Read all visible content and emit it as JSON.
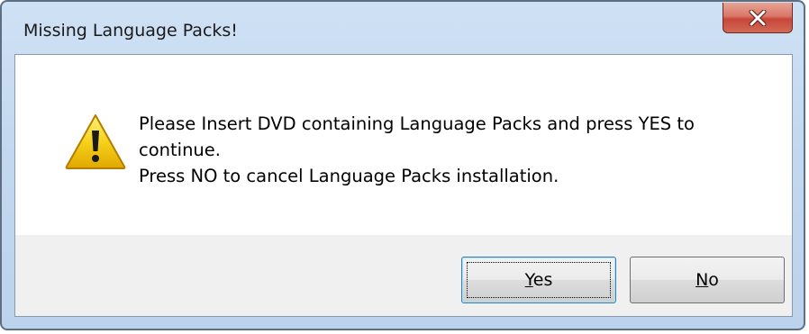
{
  "window": {
    "title": "Missing Language Packs!",
    "close_icon": "close-icon"
  },
  "dialog": {
    "icon": "warning-icon",
    "message_lines": [
      "Please Insert DVD containing Language Packs and press YES to",
      "continue.",
      "Press NO to cancel Language Packs installation."
    ]
  },
  "buttons": {
    "yes": {
      "mnemonic": "Y",
      "rest": "es",
      "default": true
    },
    "no": {
      "mnemonic": "N",
      "rest": "o"
    }
  },
  "colors": {
    "close_button": "#c7463a",
    "warning_yellow": "#f5c400",
    "title_bar": "#c4d9f0"
  }
}
